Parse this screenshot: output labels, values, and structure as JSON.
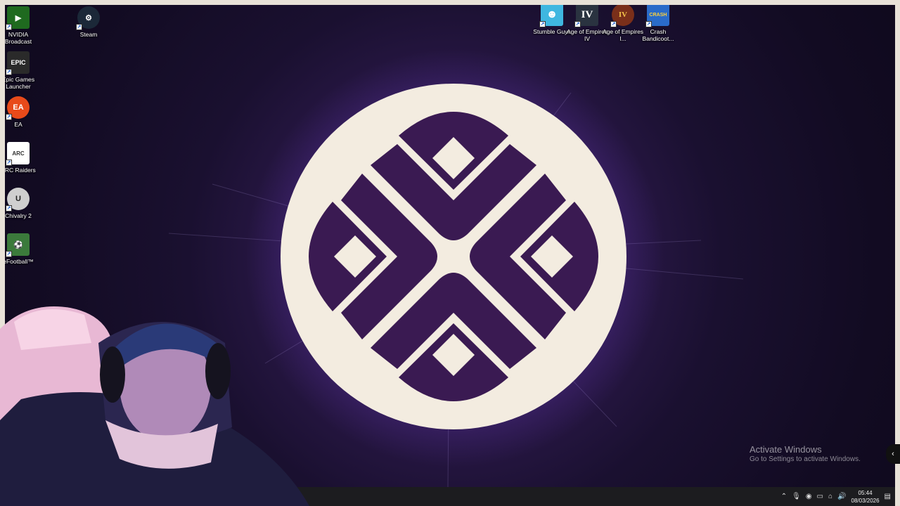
{
  "desktop_icons": [
    {
      "label": "NVIDIA Broadcast",
      "icon": "nvidia-broadcast-icon",
      "color": "#1f6a1f"
    },
    {
      "label": "Steam",
      "icon": "steam-icon",
      "color": "#1b2838"
    },
    {
      "label": "Epic Games Launcher",
      "icon": "epic-games-icon",
      "color": "#2a2a2a"
    },
    {
      "label": "EA",
      "icon": "ea-icon",
      "color": "#e84a1a"
    },
    {
      "label": "ARC Raiders",
      "icon": "arc-raiders-icon",
      "color": "#ffffff"
    },
    {
      "label": "Chivalry 2",
      "icon": "unreal-icon",
      "color": "#cfcfcf"
    },
    {
      "label": "eFootball™",
      "icon": "efootball-icon",
      "color": "#3b7a3b"
    },
    {
      "label": "Stumble Guys",
      "icon": "stumble-guys-icon",
      "color": "#3fb7e0"
    },
    {
      "label": "Age of Empires IV",
      "icon": "aoe4-icon",
      "color": "#2a3340"
    },
    {
      "label": "Age of Empires I...",
      "icon": "aoe-icon",
      "color": "#7a2f1a"
    },
    {
      "label": "Crash Bandicoot...",
      "icon": "crash-bandicoot-icon",
      "color": "#2a6bc9"
    }
  ],
  "icon_glyphs": {
    "nvidia": "▶",
    "steam": "⚙",
    "epic": "EPIC",
    "ea": "EA",
    "arc": "ARC",
    "unreal": "U",
    "efootball": "⚽",
    "stumble": "☻",
    "aoe4": "IV",
    "aoe": "IV",
    "crash": "CRASH"
  },
  "watermark": {
    "title": "Activate Windows",
    "subtitle": "Go to Settings to activate Windows."
  },
  "taskbar": {
    "tray_icons": [
      "chevron-up-icon",
      "microphone-icon",
      "nvidia-tray-icon",
      "display-icon",
      "network-icon",
      "volume-icon"
    ],
    "time": "05:44",
    "date": "08/03/2026",
    "notification_icon": "notification-icon"
  },
  "edge_button_glyph": "‹",
  "colors": {
    "emblem_fill": "#f3ece0",
    "emblem_mark": "#3a1a52",
    "glow": "#8c5ae6"
  }
}
